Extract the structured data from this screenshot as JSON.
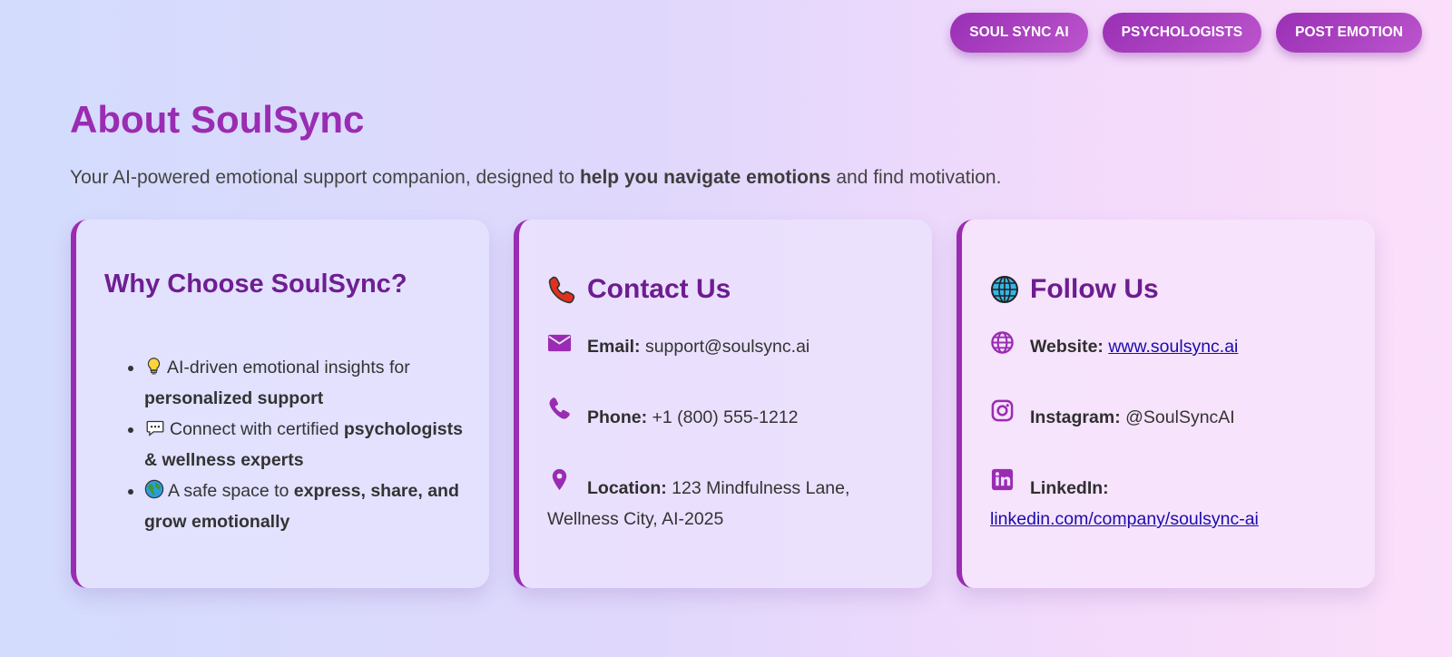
{
  "nav": {
    "items": [
      {
        "label": "SOUL SYNC AI"
      },
      {
        "label": "PSYCHOLOGISTS"
      },
      {
        "label": "POST EMOTION"
      }
    ]
  },
  "page": {
    "title": "About SoulSync",
    "subtitle_pre": "Your AI-powered emotional support companion, designed to ",
    "subtitle_bold": "help you navigate emotions",
    "subtitle_post": " and find motivation."
  },
  "why": {
    "title": "Why Choose SoulSync?",
    "items": [
      {
        "icon": "lightbulb-icon",
        "text": "AI-driven emotional insights for ",
        "bold": "personalized support",
        "after": ""
      },
      {
        "icon": "speech-bubble-icon",
        "text": "Connect with certified ",
        "bold": "psychologists & wellness experts",
        "after": ""
      },
      {
        "icon": "globe-emoji-icon",
        "text": "A safe space to ",
        "bold": "express, share, and grow emotionally",
        "after": ""
      }
    ]
  },
  "contact": {
    "title": "Contact Us",
    "title_icon": "telephone-icon",
    "email_label": "Email:",
    "email_value": "support@soulsync.ai",
    "phone_label": "Phone:",
    "phone_value": "+1 (800) 555-1212",
    "location_label": "Location:",
    "location_value": "123 Mindfulness Lane, Wellness City, AI-2025"
  },
  "follow": {
    "title": "Follow Us",
    "title_icon": "globe-icon",
    "website_label": "Website:",
    "website_value": "www.soulsync.ai",
    "instagram_label": "Instagram:",
    "instagram_value": "@SoulSyncAI",
    "linkedin_label": "LinkedIn:",
    "linkedin_value": "linkedin.com/company/soulsync-ai"
  },
  "colors": {
    "accent": "#9a2cb2",
    "card_title": "#6c1d8f",
    "link": "#1a0dab"
  }
}
